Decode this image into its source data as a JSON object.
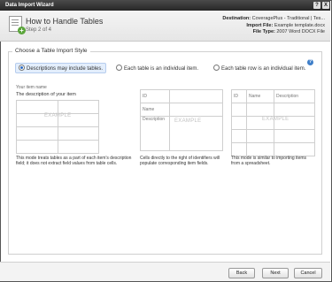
{
  "window": {
    "title": "Data Import Wizard",
    "help_btn": "?",
    "close_btn": "X"
  },
  "header": {
    "title": "How to Handle Tables",
    "step": "Step 2 of 4",
    "destination_label": "Destination:",
    "destination_value": "CoveragePlus - Traditional | Tes...",
    "import_file_label": "Import File:",
    "import_file_value": "Example template.docx",
    "file_type_label": "File Type:",
    "file_type_value": "2007 Word DOCX File"
  },
  "group": {
    "legend": "Choose a Table Import Style",
    "options": [
      {
        "label": "Descriptions may include tables.",
        "selected": true
      },
      {
        "label": "Each table is an individual item.",
        "selected": false
      },
      {
        "label": "Each table row is an individual item.",
        "selected": false
      }
    ]
  },
  "example1": {
    "item_name_label": "Your item name",
    "description": "The description of your item",
    "watermark": "EXAMPLE",
    "note": "This mode treats tables as a part of each item's description field; it does not extract field values from table cells."
  },
  "example2": {
    "fields": [
      "ID",
      "Name",
      "Description"
    ],
    "watermark": "EXAMPLE",
    "note": "Cells directly to the right of identifiers will populate corresponding item fields."
  },
  "example3": {
    "columns": [
      "ID",
      "Name",
      "Description"
    ],
    "watermark": "EXAMPLE",
    "note": "This mode is similar to importing items from a spreadsheet."
  },
  "footer": {
    "back": "Back",
    "next": "Next",
    "cancel": "Cancel"
  }
}
